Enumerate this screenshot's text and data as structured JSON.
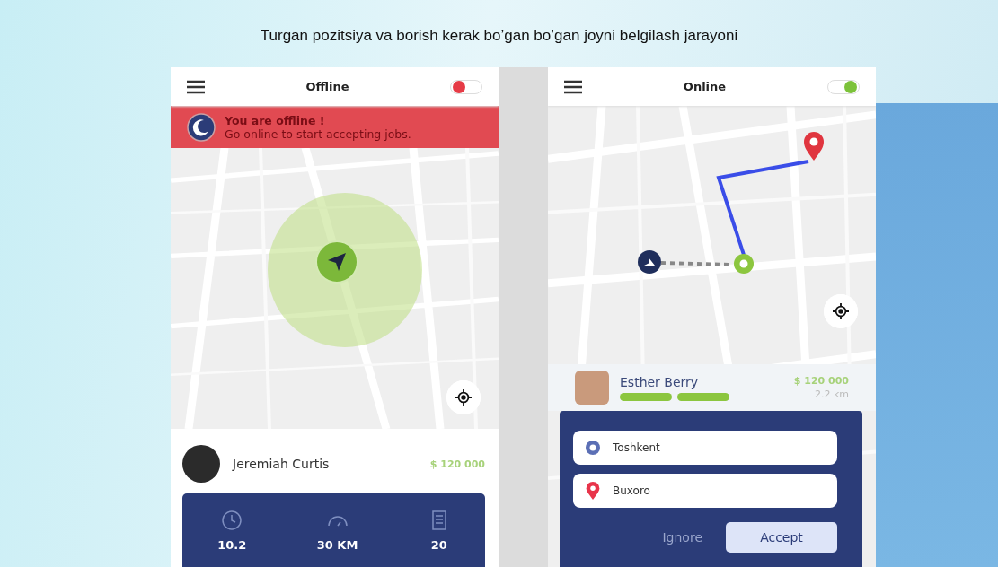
{
  "slide_title": "Turgan pozitsiya va borish kerak bo’gan  bo’gan joyni belgilash jarayoni",
  "offline_screen": {
    "title": "Offline",
    "on": false,
    "banner": {
      "heading": "You are offline !",
      "message": "Go online to start accepting jobs."
    },
    "driver": {
      "name": "Jeremiah Curtis",
      "price": "$ 120 000"
    },
    "stats": [
      {
        "kind": "clock",
        "value": "10.2"
      },
      {
        "kind": "speed",
        "value": "30 KM"
      },
      {
        "kind": "list",
        "value": "20"
      }
    ]
  },
  "online_screen": {
    "title": "Online",
    "on": true,
    "rider": {
      "name": "Esther Berry",
      "price": "$ 120 000",
      "distance": "2.2 km"
    },
    "route": [
      {
        "kind": "origin",
        "place": "Toshkent"
      },
      {
        "kind": "destination",
        "place": "Buxoro"
      }
    ],
    "buttons": [
      {
        "label": "Ignore",
        "kind": "text"
      },
      {
        "label": "Accept",
        "kind": "filled"
      }
    ]
  }
}
